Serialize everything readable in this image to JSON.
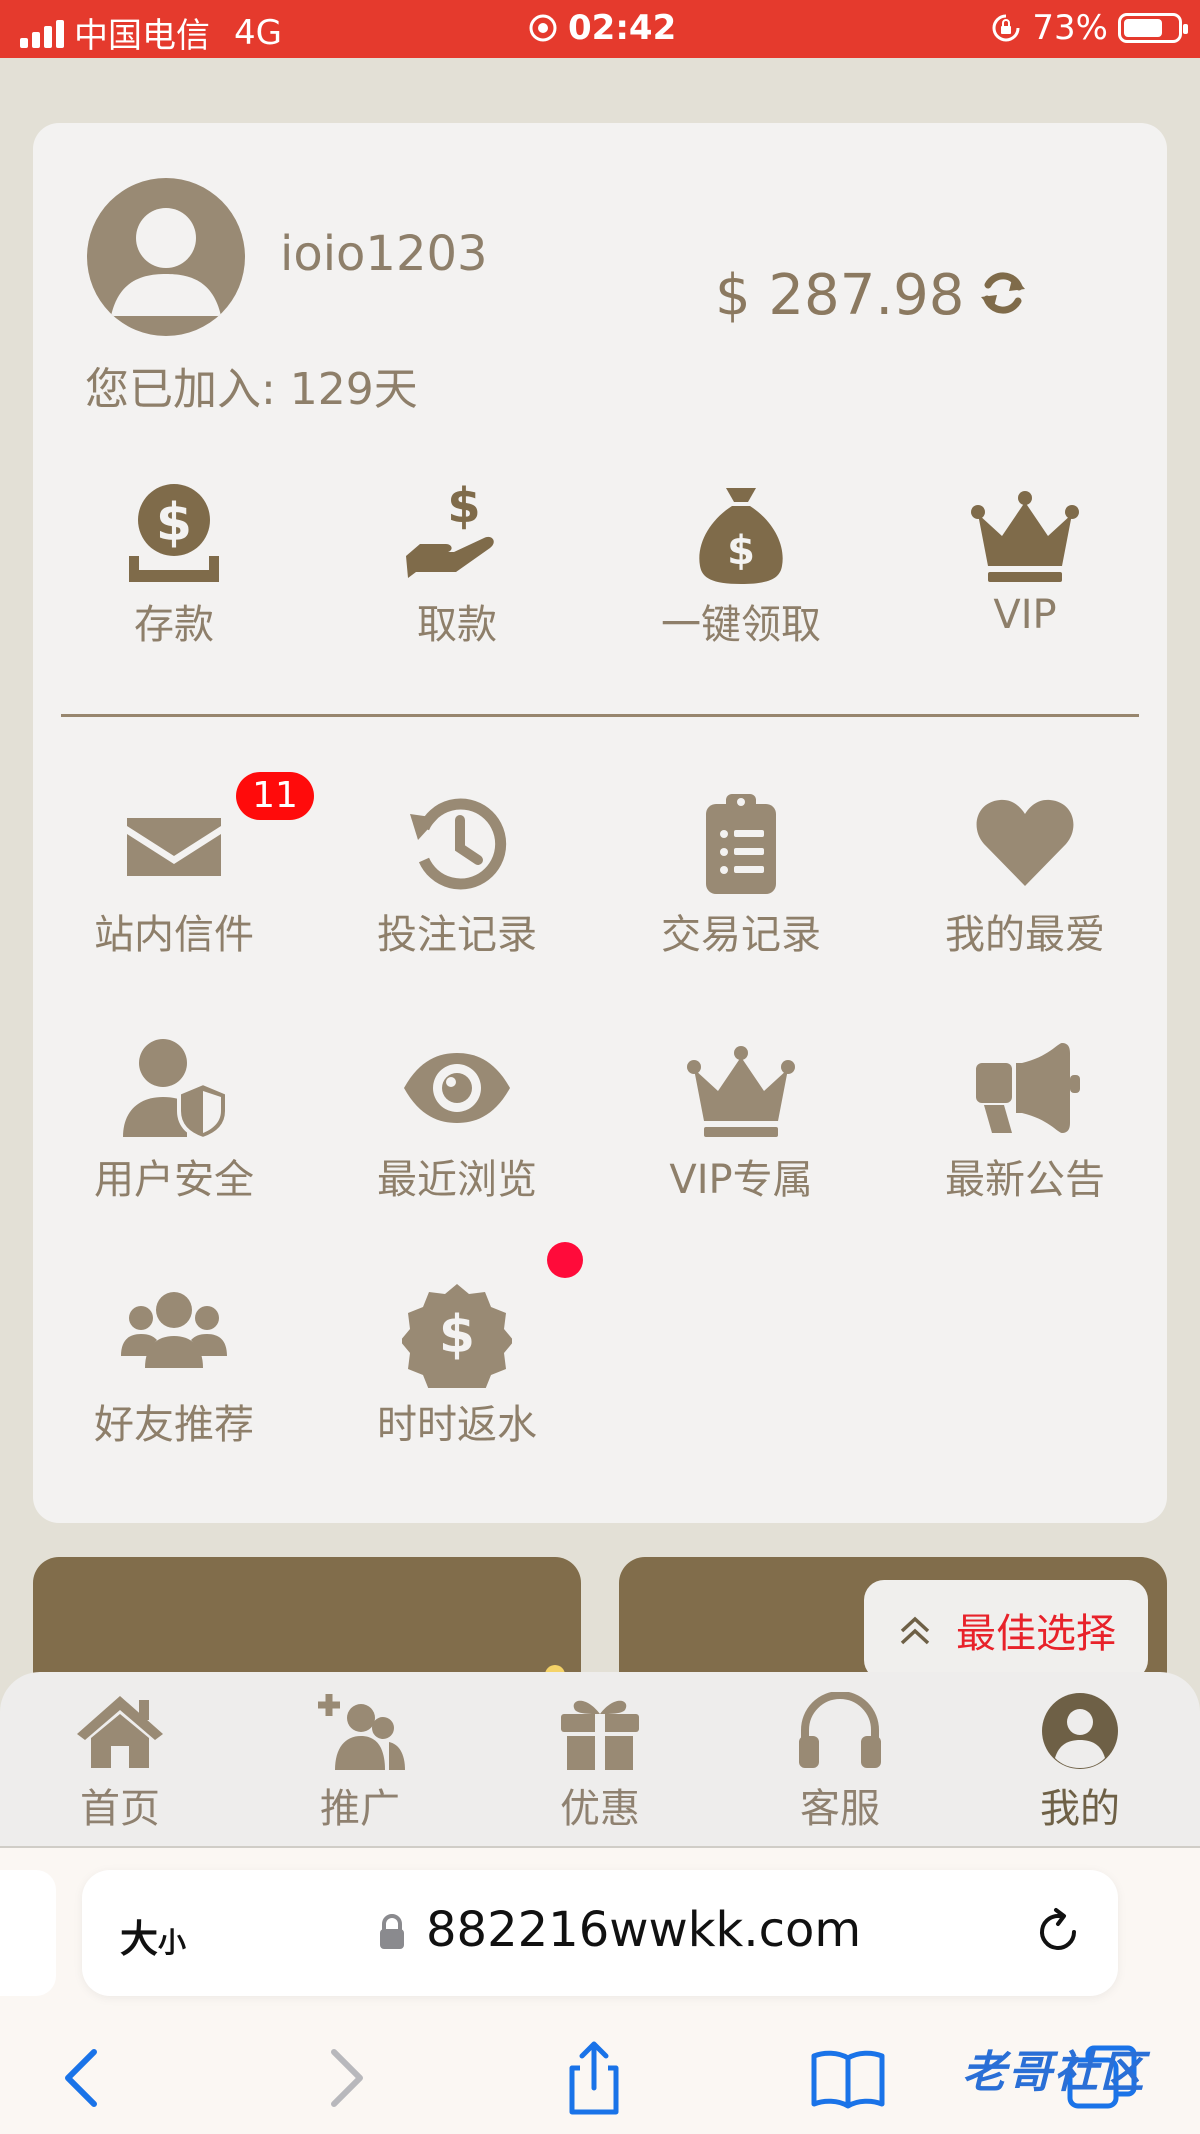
{
  "status_bar": {
    "carrier": "中国电信",
    "network": "4G",
    "time": "02:42",
    "battery": "73%",
    "battery_level": 0.73
  },
  "profile": {
    "username": "ioio1203",
    "balance": "$ 287.98",
    "joined": "您已加入: 129天"
  },
  "quick_actions": [
    {
      "label": "存款",
      "icon": "coin-deposit-icon"
    },
    {
      "label": "取款",
      "icon": "hand-dollar-icon"
    },
    {
      "label": "一键领取",
      "icon": "money-bag-icon"
    },
    {
      "label": "VIP",
      "icon": "crown-icon"
    }
  ],
  "menu": [
    {
      "label": "站内信件",
      "icon": "envelope-icon",
      "badge": "11"
    },
    {
      "label": "投注记录",
      "icon": "history-icon"
    },
    {
      "label": "交易记录",
      "icon": "clipboard-list-icon"
    },
    {
      "label": "我的最爱",
      "icon": "heart-icon"
    },
    {
      "label": "用户安全",
      "icon": "user-shield-icon"
    },
    {
      "label": "最近浏览",
      "icon": "eye-icon"
    },
    {
      "label": "VIP专属",
      "icon": "crown-icon"
    },
    {
      "label": "最新公告",
      "icon": "megaphone-icon"
    },
    {
      "label": "好友推荐",
      "icon": "users-icon"
    },
    {
      "label": "时时返水",
      "icon": "dollar-badge-icon"
    }
  ],
  "best_choice": {
    "label": "最佳选择"
  },
  "nav": [
    {
      "label": "首页",
      "icon": "home-icon"
    },
    {
      "label": "推广",
      "icon": "user-plus-icon"
    },
    {
      "label": "优惠",
      "icon": "gift-icon"
    },
    {
      "label": "客服",
      "icon": "headset-icon"
    },
    {
      "label": "我的",
      "icon": "user-circle-icon",
      "active": true
    }
  ],
  "browser": {
    "text_size": "大",
    "text_size_small": "小",
    "url": "882216wwkk.com"
  },
  "watermark": "老哥社区",
  "colors": {
    "status": "#e53a2d",
    "icon": "#998a74",
    "icon_dark": "#7f6b4a",
    "badge": "#ff0b0b",
    "accent_red": "#e8222a"
  }
}
